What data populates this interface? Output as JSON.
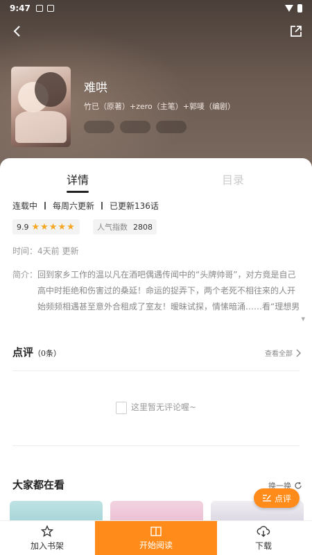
{
  "status": {
    "time": "9:47"
  },
  "book": {
    "title": "难哄",
    "authors": "竹已（原著）+zero（主笔）+郭唛（编剧）",
    "tags": [
      "",
      "",
      ""
    ]
  },
  "tabs": {
    "detail": "详情",
    "catalog": "目录"
  },
  "meta": {
    "status": "连载中",
    "schedule": "每周六更新",
    "updated": "已更新136话"
  },
  "rating": {
    "score": "9.9",
    "stars": "★★★★★"
  },
  "popularity": {
    "label": "人气指数",
    "value": "2808"
  },
  "time_row": "时间：4天前 更新",
  "intro": {
    "label": "简介：",
    "text": "回到家乡工作的温以凡在酒吧偶遇传闻中的“头牌帅哥”，对方竟是自己高中时拒绝和伤害过的桑延！命运的捉弄下，两个老死不相往来的人开始频频相遇甚至意外合租成了室友！暧昧试探，情愫暗涌……看“理想男友天花板”桑延演绎深情蜜恋！【即将上架/..."
  },
  "reviews": {
    "title": "点评",
    "count": "（0条）",
    "view_all": "查看全部",
    "empty_text": "这里暂无评论喔~"
  },
  "popular": {
    "title": "大家都在看",
    "refresh": "换一换"
  },
  "fab": {
    "label": "点评"
  },
  "bottombar": {
    "bookshelf": "加入书架",
    "read": "开始阅读",
    "download": "下载"
  },
  "colors": {
    "accent": "#ff8c1a",
    "star": "#f5a623"
  }
}
